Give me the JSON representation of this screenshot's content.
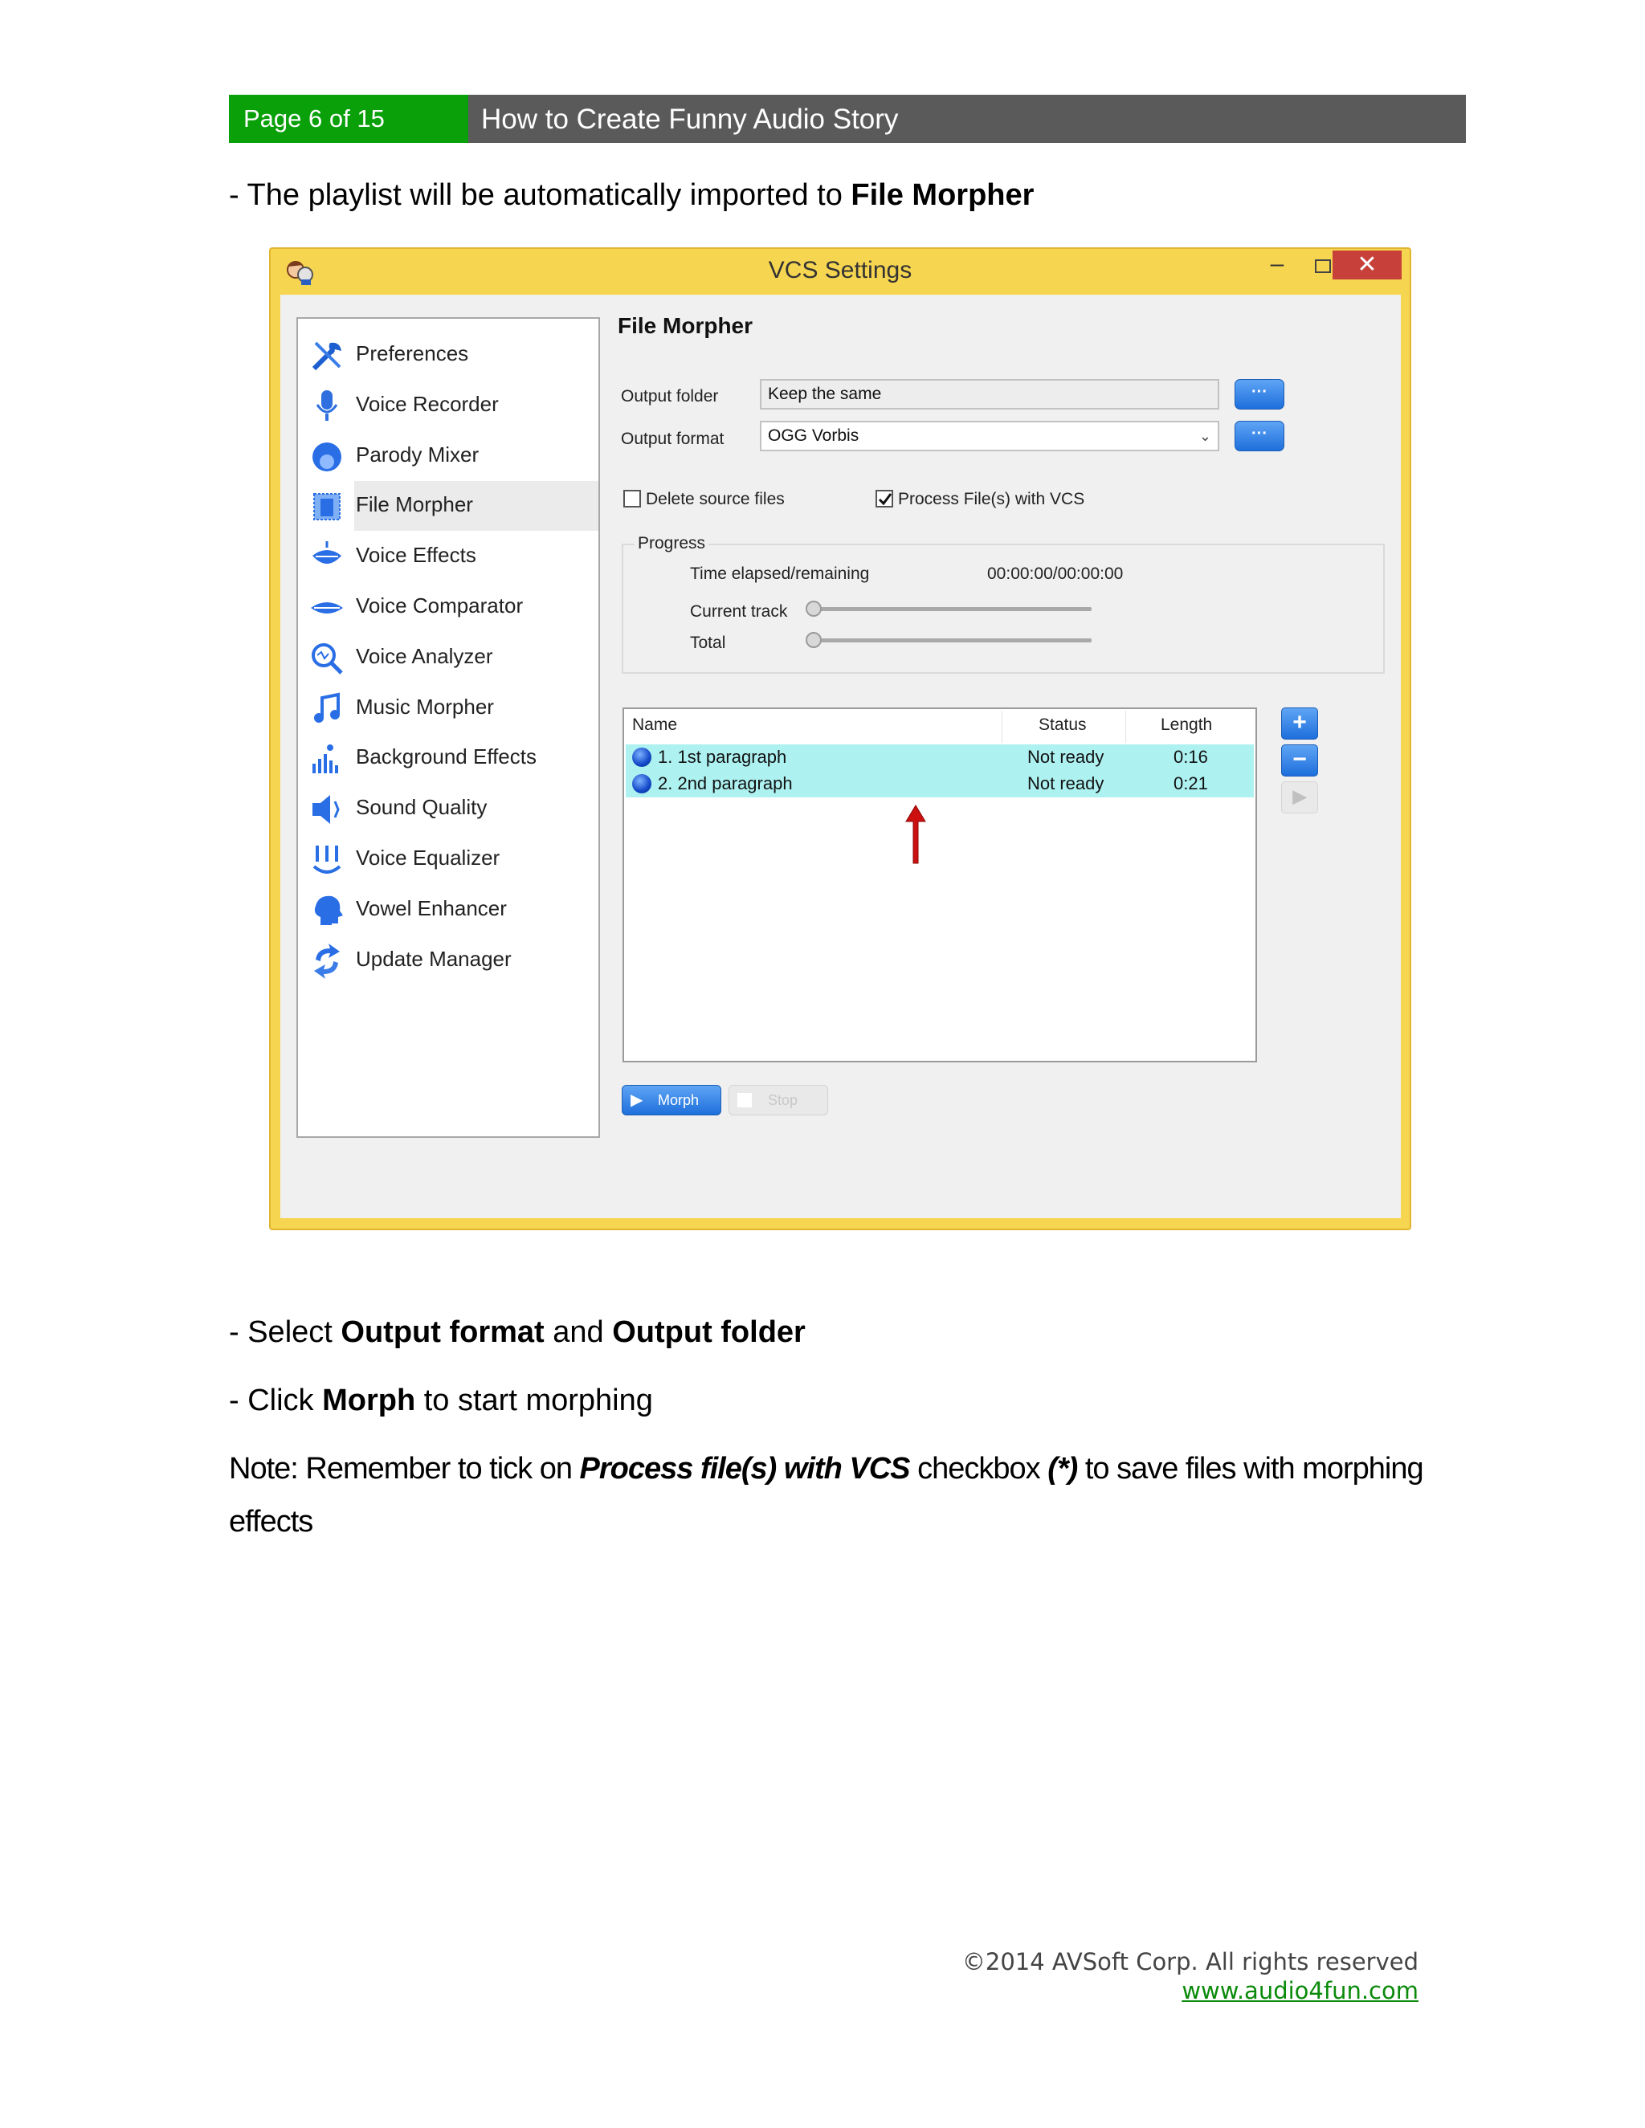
{
  "header": {
    "page_indicator": "Page 6 of 15",
    "title": "How to Create Funny Audio Story"
  },
  "intro_text": {
    "prefix": "- The playlist will be automatically imported to ",
    "bold": "File Morpher"
  },
  "window": {
    "title": "VCS Settings",
    "minimize": "–",
    "close": "✕",
    "sidebar": {
      "items": [
        {
          "label": "Preferences",
          "icon": "tools-icon"
        },
        {
          "label": "Voice Recorder",
          "icon": "microphone-icon"
        },
        {
          "label": "Parody Mixer",
          "icon": "face-icon"
        },
        {
          "label": "File Morpher",
          "icon": "file-morpher-icon",
          "active": true
        },
        {
          "label": "Voice Effects",
          "icon": "lips-icon"
        },
        {
          "label": "Voice Comparator",
          "icon": "lips-compare-icon"
        },
        {
          "label": "Voice Analyzer",
          "icon": "magnifier-icon"
        },
        {
          "label": "Music Morpher",
          "icon": "music-note-icon"
        },
        {
          "label": "Background Effects",
          "icon": "equalizer-bars-icon"
        },
        {
          "label": "Sound Quality",
          "icon": "speaker-icon"
        },
        {
          "label": "Voice Equalizer",
          "icon": "equalizer-icon"
        },
        {
          "label": "Vowel Enhancer",
          "icon": "head-profile-icon"
        },
        {
          "label": "Update Manager",
          "icon": "refresh-icon"
        }
      ]
    },
    "panel": {
      "title": "File Morpher",
      "output_folder_label": "Output folder",
      "output_folder_value": "Keep the same",
      "output_format_label": "Output format",
      "output_format_value": "OGG Vorbis",
      "browse_label": "···",
      "delete_source_label": "Delete source files",
      "delete_source_checked": false,
      "process_vcs_label": "Process File(s) with VCS",
      "process_vcs_checked": true,
      "progress": {
        "group_label": "Progress",
        "time_label": "Time elapsed/remaining",
        "time_value": "00:00:00/00:00:00",
        "current_track_label": "Current track",
        "total_label": "Total",
        "current_track_fraction": 0,
        "total_fraction": 0
      },
      "list": {
        "columns": [
          "Name",
          "Status",
          "Length"
        ],
        "rows": [
          {
            "name": "1.  1st paragraph",
            "status": "Not ready",
            "length": "0:16"
          },
          {
            "name": "2.  2nd paragraph",
            "status": "Not ready",
            "length": "0:21"
          }
        ]
      },
      "add_label": "+",
      "remove_label": "−",
      "play_label": "▶",
      "morph_label": "Morph",
      "stop_label": "Stop"
    }
  },
  "instructions": {
    "line1": {
      "prefix": "- Select ",
      "bold1": "Output format",
      "mid": " and ",
      "bold2": "Output folder"
    },
    "line2": {
      "prefix": "- Click ",
      "bold": "Morph",
      "suffix": " to start morphing"
    },
    "note": {
      "prefix": "Note: Remember to tick on ",
      "emph": "Process file(s) with VCS",
      "mid": " checkbox ",
      "emph2": "(*)",
      "suffix": " to save files with morphing",
      "line2": "effects"
    }
  },
  "footer": {
    "copyright": "©2014 AVSoft Corp. All rights reserved",
    "link": "www.audio4fun.com"
  },
  "colors": {
    "header_green": "#0aa00a",
    "header_gray": "#5a5a5a",
    "window_frame": "#f6d551",
    "close_red": "#c7403a",
    "accent_blue": "#1e6fdc",
    "row_highlight": "#aef1f1",
    "arrow_red": "#cc1010",
    "link_green": "#0a8a0a"
  }
}
